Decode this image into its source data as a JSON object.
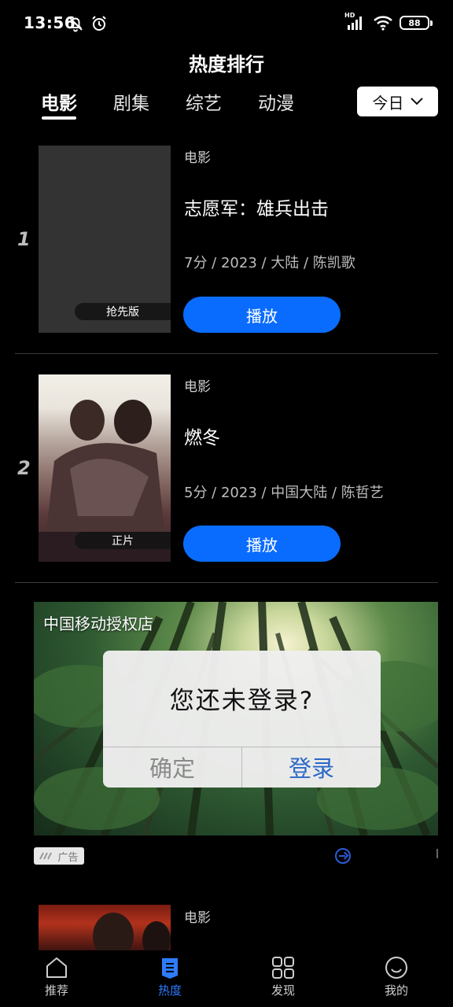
{
  "status_bar": {
    "time": "13:56",
    "network_label": "HD",
    "battery": "88",
    "icons": [
      "mute-bell-icon",
      "alarm-icon",
      "signal-icon",
      "wifi-icon",
      "battery-icon"
    ]
  },
  "header": {
    "title": "热度排行",
    "tabs": [
      {
        "label": "电影",
        "active": true
      },
      {
        "label": "剧集",
        "active": false
      },
      {
        "label": "综艺",
        "active": false
      },
      {
        "label": "动漫",
        "active": false
      }
    ],
    "date_filter": "今日"
  },
  "items": [
    {
      "rank": "1",
      "category": "电影",
      "title": "志愿军：雄兵出击",
      "info": "7分 / 2023 / 大陆 / 陈凯歌",
      "badge": "抢先版",
      "play_label": "播放"
    },
    {
      "rank": "2",
      "category": "电影",
      "title": "燃冬",
      "info": "5分 / 2023 / 中国大陆 / 陈哲艺",
      "badge": "正片",
      "play_label": "播放"
    },
    {
      "rank": "",
      "category": "电影",
      "title": "",
      "info": "",
      "badge": "",
      "play_label": ""
    }
  ],
  "ad": {
    "title": "中国移动授权店",
    "tag": "广告"
  },
  "dialog": {
    "message": "您还未登录?",
    "ok_label": "确定",
    "login_label": "登录"
  },
  "bottom_nav": [
    {
      "label": "推荐",
      "icon": "home-icon",
      "active": false
    },
    {
      "label": "热度",
      "icon": "hot-list-icon",
      "active": true
    },
    {
      "label": "发现",
      "icon": "grid-icon",
      "active": false
    },
    {
      "label": "我的",
      "icon": "smiley-icon",
      "active": false
    }
  ],
  "colors": {
    "accent": "#0a6cff",
    "nav_active": "#2f7bff",
    "dialog_login": "#2b67c6",
    "background": "#000000"
  }
}
